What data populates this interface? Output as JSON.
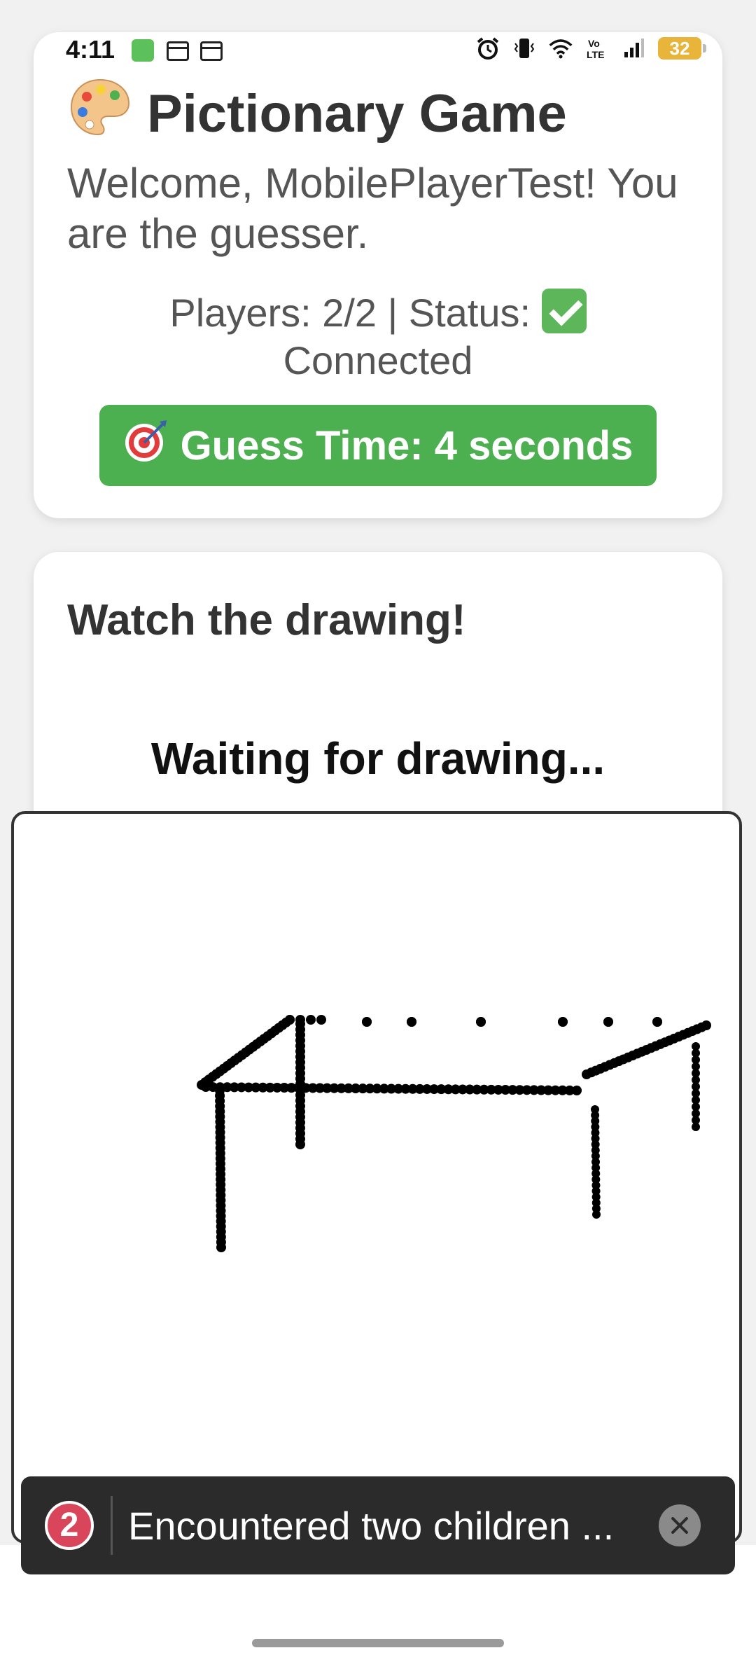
{
  "status_bar": {
    "time": "4:11",
    "battery": "32"
  },
  "header": {
    "title": "Pictionary Game",
    "title_icon": "palette-icon",
    "welcome": "Welcome, MobilePlayerTest! You are the guesser.",
    "players_status": "Players: 2/2 | Status:",
    "status_icon": "check-icon",
    "status_text": "Connected",
    "guess_icon": "target-icon",
    "guess_time": "Guess Time: 4 seconds",
    "guess_color": "#4caf50"
  },
  "drawing": {
    "heading": "Watch the drawing!",
    "waiting": "Waiting for drawing..."
  },
  "toast": {
    "count": "2",
    "message": "Encountered two children ...",
    "badge_color": "#d9455b"
  }
}
